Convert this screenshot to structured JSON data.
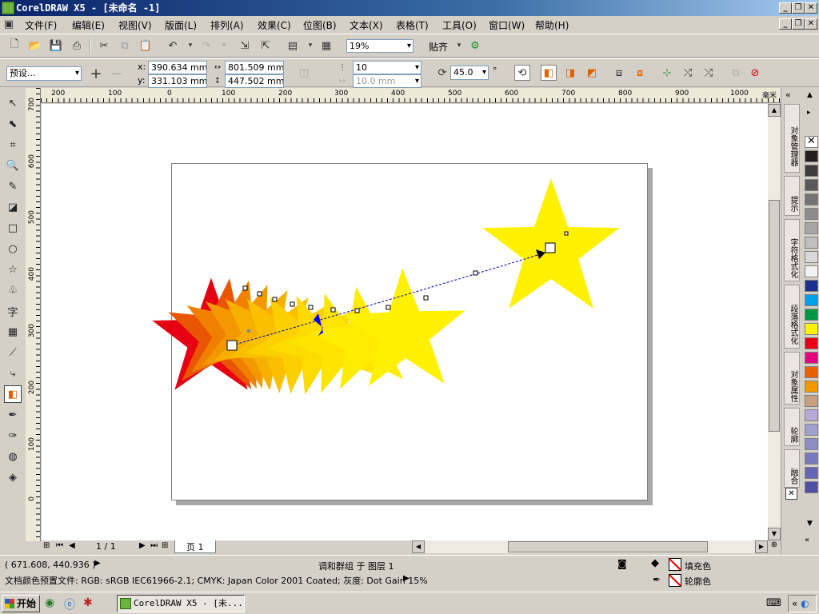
{
  "titlebar": {
    "title": "CorelDRAW X5 - [未命名 -1]"
  },
  "menu": [
    {
      "label": "文件(F)"
    },
    {
      "label": "编辑(E)"
    },
    {
      "label": "视图(V)"
    },
    {
      "label": "版面(L)"
    },
    {
      "label": "排列(A)"
    },
    {
      "label": "效果(C)"
    },
    {
      "label": "位图(B)"
    },
    {
      "label": "文本(X)"
    },
    {
      "label": "表格(T)"
    },
    {
      "label": "工具(O)"
    },
    {
      "label": "窗口(W)"
    },
    {
      "label": "帮助(H)"
    }
  ],
  "standard_toolbar": {
    "zoom": "19%",
    "snap_label": "贴齐"
  },
  "property_bar": {
    "preset": "预设...",
    "x_label": "x:",
    "x_value": "390.634 mm",
    "y_label": "y:",
    "y_value": "331.103 mm",
    "width_value": "801.509 mm",
    "height_value": "447.502 mm",
    "steps_value": "10",
    "spacing_value": "10.0 mm",
    "rotation_value": "45.0",
    "degree_symbol": "°"
  },
  "rulers": {
    "h_labels": [
      "200",
      "100",
      "0",
      "100",
      "200",
      "300",
      "400",
      "500",
      "600",
      "700",
      "800",
      "900",
      "1000"
    ],
    "h_unit": "毫米",
    "v_labels": [
      "700",
      "600",
      "500",
      "400",
      "300",
      "200",
      "100",
      "0"
    ]
  },
  "page_nav": {
    "counter": "1 / 1",
    "tab": "页 1"
  },
  "dockers": [
    {
      "label": "对象管理器"
    },
    {
      "label": "提示"
    },
    {
      "label": "字符格式化"
    },
    {
      "label": "段落格式化"
    },
    {
      "label": "对象属性"
    },
    {
      "label": "轮廓"
    },
    {
      "label": "融合"
    }
  ],
  "palette": [
    "#ffffff",
    "#231f20",
    "#3c3c3c",
    "#595959",
    "#737373",
    "#8c8c8c",
    "#a6a6a6",
    "#bfbfbf",
    "#d9d9d9",
    "#f2f2f2",
    "#1b2f8f",
    "#00a0e9",
    "#009944",
    "#fff100",
    "#e60012",
    "#e4007f",
    "#eb6100",
    "#f39800",
    "#c8a080",
    "#b8a8d8",
    "#a0a0d0",
    "#8c8cc8",
    "#7878c0",
    "#6464b8",
    "#5050a8"
  ],
  "status": {
    "coords": "( 671.608, 440.936 )",
    "selection_info": "调和群组 于 图层 1",
    "color_profile": "文档颜色预置文件: RGB: sRGB IEC61966-2.1; CMYK: Japan Color 2001 Coated; 灰度: Dot Gain 15%",
    "fill_label": "填充色",
    "outline_label": "轮廓色"
  },
  "taskbar": {
    "start": "开始",
    "task": "CorelDRAW X5 - [未..."
  }
}
